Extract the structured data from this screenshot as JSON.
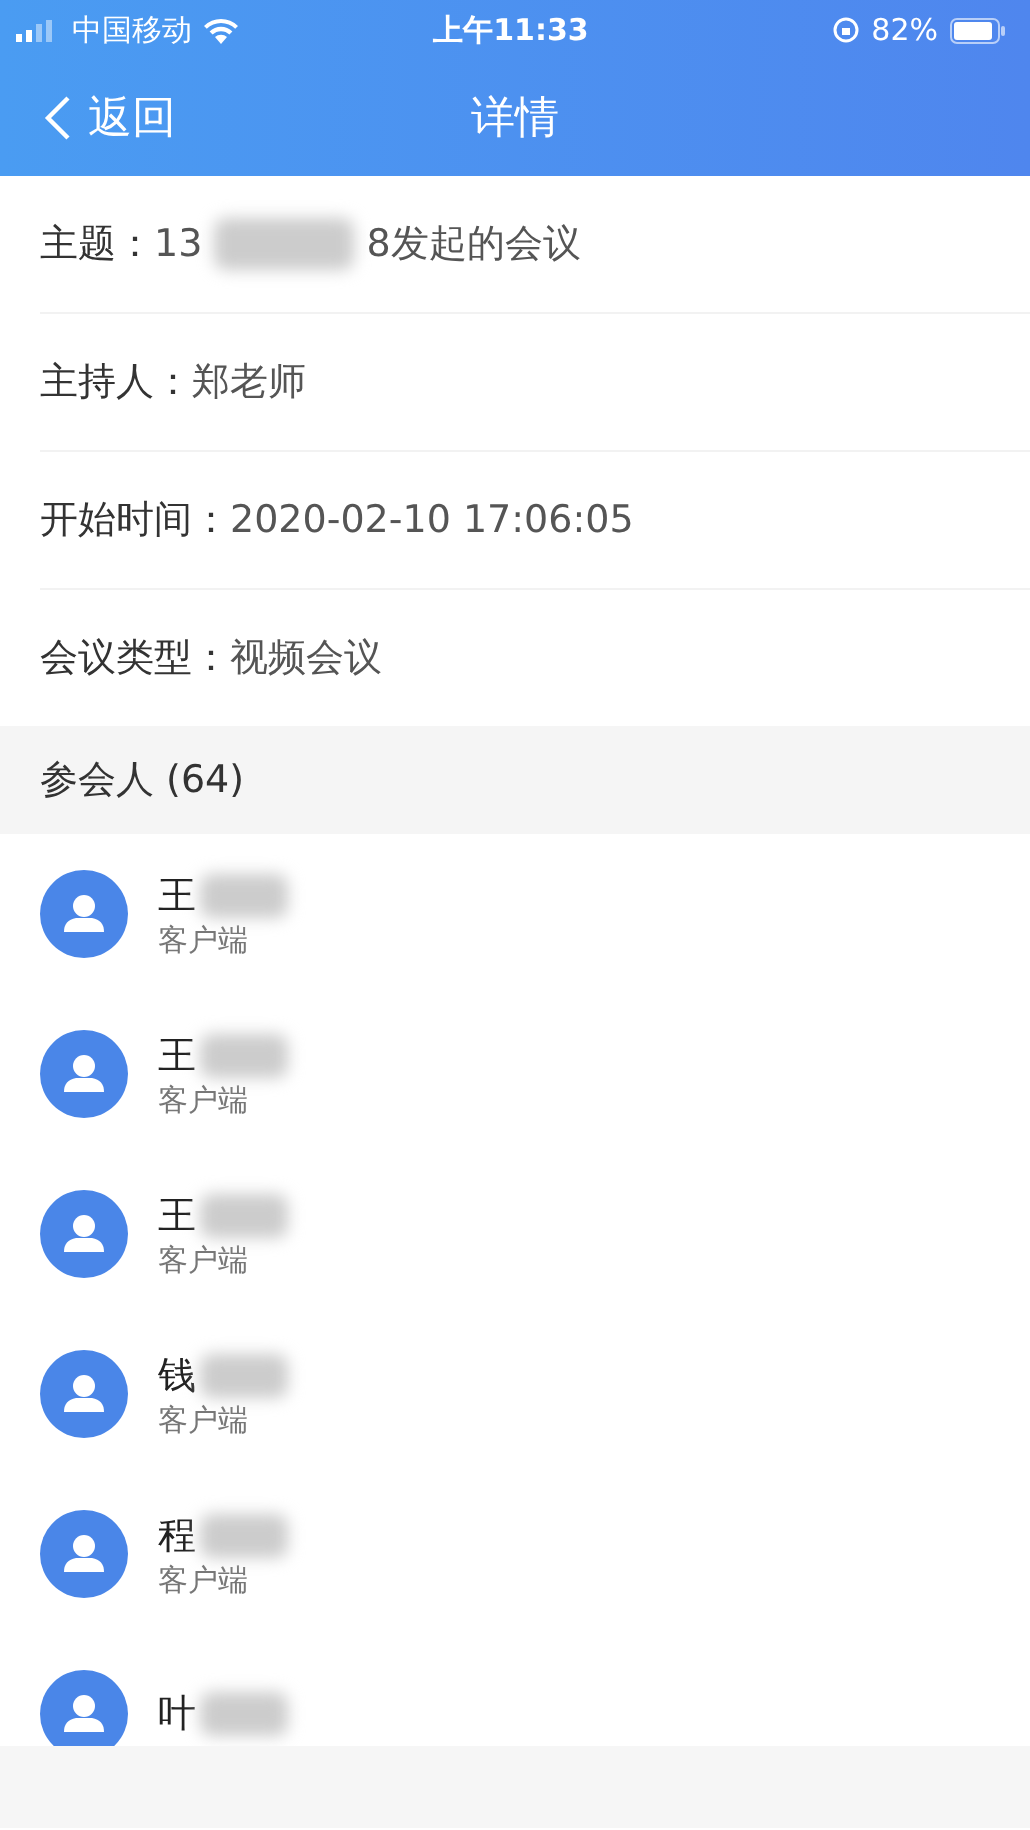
{
  "status_bar": {
    "carrier": "中国移动",
    "time": "上午11:33",
    "battery": "82%"
  },
  "nav": {
    "back": "返回",
    "title": "详情"
  },
  "details": [
    {
      "label": "主题：",
      "value_start": "13",
      "value_end": "8发起的会议"
    },
    {
      "label": "主持人：",
      "value_start": "郑老师"
    },
    {
      "label": "开始时间：",
      "value_start": "2020-02-10 17:06:05"
    },
    {
      "label": "会议类型：",
      "value_start": "视频会议"
    }
  ],
  "participants_header": "参会人 (64)",
  "participants": [
    {
      "name": "王",
      "client": "客户端"
    },
    {
      "name": "王",
      "client": "客户端"
    },
    {
      "name": "王",
      "client": "客户端"
    },
    {
      "name": "钱",
      "client": "客户端"
    },
    {
      "name": "程",
      "client": "客户端"
    },
    {
      "name": "叶"
    }
  ]
}
